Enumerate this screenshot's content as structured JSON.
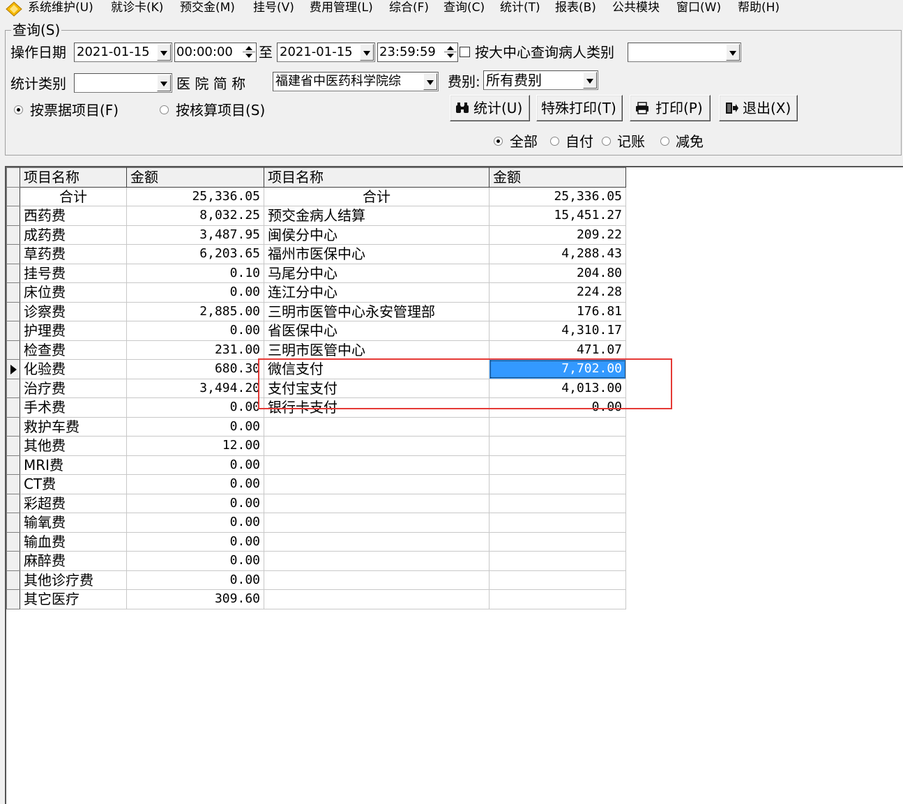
{
  "menu": {
    "items": [
      "系统维护(U)",
      "就诊卡(K)",
      "预交金(M)",
      "挂号(V)",
      "费用管理(L)",
      "综合(F)",
      "查询(C)",
      "统计(T)",
      "报表(B)",
      "公共模块",
      "窗口(W)",
      "帮助(H)"
    ]
  },
  "query": {
    "group_label": "查询(S)",
    "op_date_label": "操作日期",
    "start_date": "2021-01-15",
    "start_time": "00:00:00",
    "to_label": "至",
    "end_date": "2021-01-15",
    "end_time": "23:59:59",
    "center_check_label": "按大中心查询病人类别",
    "center_category_value": "",
    "stat_category_label": "统计类别",
    "stat_category_value": "",
    "hospital_label": "医 院 简 称",
    "hospital_value": "福建省中医药科学院综",
    "fee_type_label": "费别:",
    "fee_type_value": "所有费别",
    "radio_bill_item": "按票据项目(F)",
    "radio_account_item": "按核算项目(S)",
    "btn_stat": "统计(U)",
    "btn_special_print": "特殊打印(T)",
    "btn_print": "打印(P)",
    "btn_exit": "退出(X)",
    "pay_filter": {
      "all": "全部",
      "self": "自付",
      "account": "记账",
      "waive": "减免",
      "selected": "全部"
    }
  },
  "grid": {
    "headers": [
      "项目名称",
      "金额",
      "项目名称",
      "金额"
    ],
    "rows": [
      [
        "合计",
        "25,336.05",
        "合计",
        "25,336.05"
      ],
      [
        "西药费",
        "8,032.25",
        "预交金病人结算",
        "15,451.27"
      ],
      [
        "成药费",
        "3,487.95",
        "闽侯分中心",
        "209.22"
      ],
      [
        "草药费",
        "6,203.65",
        "福州市医保中心",
        "4,288.43"
      ],
      [
        "挂号费",
        "0.10",
        "马尾分中心",
        "204.80"
      ],
      [
        "床位费",
        "0.00",
        "连江分中心",
        "224.28"
      ],
      [
        "诊察费",
        "2,885.00",
        "三明市医管中心永安管理部",
        "176.81"
      ],
      [
        "护理费",
        "0.00",
        "省医保中心",
        "4,310.17"
      ],
      [
        "检查费",
        "231.00",
        "三明市医管中心",
        "471.07"
      ],
      [
        "化验费",
        "680.30",
        "微信支付",
        "7,702.00"
      ],
      [
        "治疗费",
        "3,494.20",
        "支付宝支付",
        "4,013.00"
      ],
      [
        "手术费",
        "0.00",
        "银行卡支付",
        "0.00"
      ],
      [
        "救护车费",
        "0.00",
        "",
        ""
      ],
      [
        "其他费",
        "12.00",
        "",
        ""
      ],
      [
        "MRI费",
        "0.00",
        "",
        ""
      ],
      [
        "CT费",
        "0.00",
        "",
        ""
      ],
      [
        "彩超费",
        "0.00",
        "",
        ""
      ],
      [
        "输氧费",
        "0.00",
        "",
        ""
      ],
      [
        "输血费",
        "0.00",
        "",
        ""
      ],
      [
        "麻醉费",
        "0.00",
        "",
        ""
      ],
      [
        "其他诊疗费",
        "0.00",
        "",
        ""
      ],
      [
        "其它医疗",
        "309.60",
        "",
        ""
      ]
    ],
    "current_row": 9,
    "selected_cell": [
      9,
      3
    ]
  },
  "colors": {
    "selection": "#3399ff",
    "highlight_box": "#e53935"
  }
}
